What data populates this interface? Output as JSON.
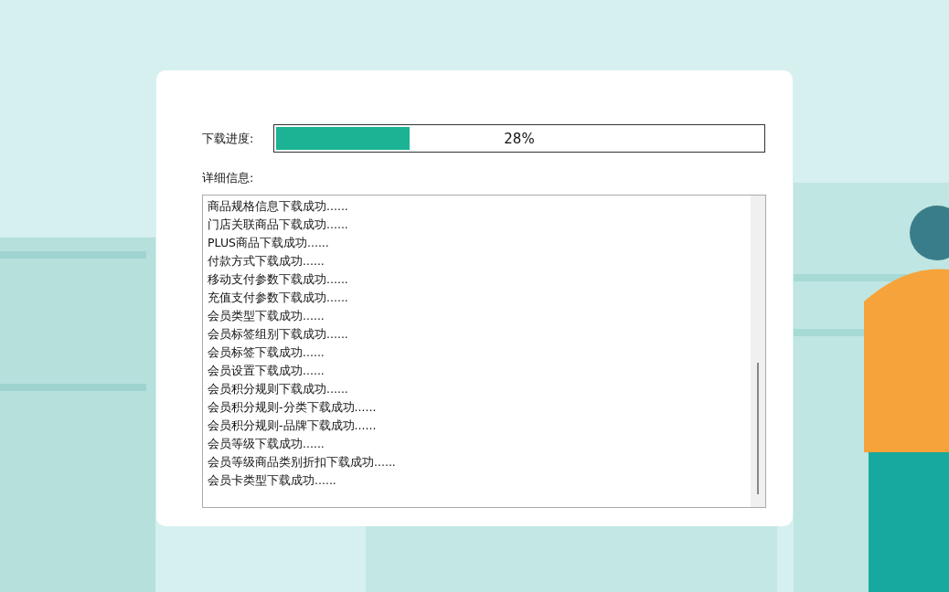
{
  "progress": {
    "label": "下载进度:",
    "level": 0.28,
    "reading": "28%"
  },
  "details": {
    "label": "详细信息:",
    "lines": [
      "商品规格信息下载成功......",
      "门店关联商品下载成功......",
      "PLUS商品下载成功......",
      "付款方式下载成功......",
      "移动支付参数下载成功......",
      "充值支付参数下载成功......",
      "会员类型下载成功......",
      "会员标签组别下载成功......",
      "会员标签下载成功......",
      "会员设置下载成功......",
      "会员积分规则下载成功......",
      "会员积分规则-分类下载成功......",
      "会员积分规则-品牌下载成功......",
      "会员等级下载成功......",
      "会员等级商品类别折扣下载成功......",
      "会员卡类型下载成功......"
    ]
  }
}
